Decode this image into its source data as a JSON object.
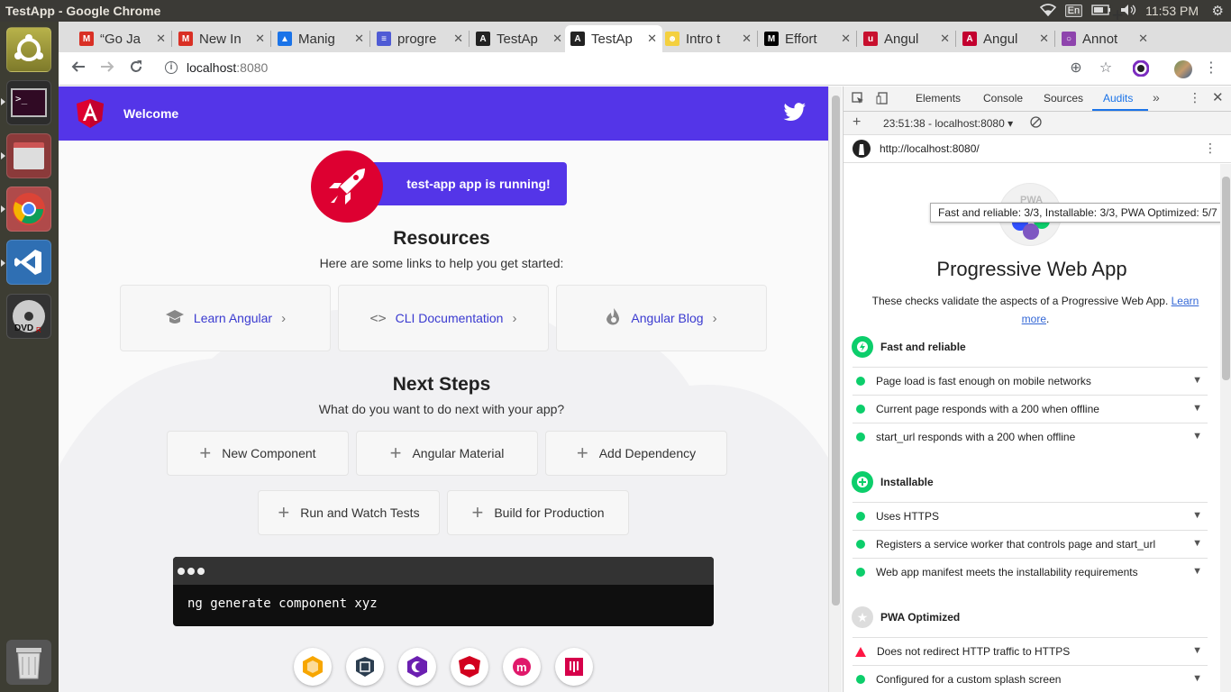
{
  "window": {
    "title": "TestApp - Google Chrome"
  },
  "tray": {
    "keyboard": "En",
    "clock": "11:53 PM"
  },
  "launcher": {
    "items": [
      "ubuntu-home-icon",
      "terminal-icon",
      "files-icon",
      "chrome-icon",
      "vscode-icon",
      "dvd-icon",
      "trash-icon"
    ]
  },
  "tabs": [
    {
      "title": "“Go Ja",
      "favicon": "gmail",
      "color": "#d93025"
    },
    {
      "title": "New In",
      "favicon": "gmail",
      "color": "#d93025"
    },
    {
      "title": "Manig",
      "favicon": "drive",
      "color": "#1a73e8"
    },
    {
      "title": "progre",
      "favicon": "docs",
      "color": "#4f5bd5"
    },
    {
      "title": "TestAp",
      "favicon": "angular",
      "color": "#222"
    },
    {
      "title": "TestAp",
      "favicon": "angular",
      "color": "#222",
      "active": true
    },
    {
      "title": "Intro t",
      "favicon": "intro",
      "color": "#f4d03f"
    },
    {
      "title": "Effort",
      "favicon": "medium",
      "color": "#000"
    },
    {
      "title": "Angul",
      "favicon": "udemy",
      "color": "#c8102e"
    },
    {
      "title": "Angul",
      "favicon": "angular-red",
      "color": "#c3002f"
    },
    {
      "title": "Annot",
      "favicon": "annot",
      "color": "#8e44ad"
    }
  ],
  "address": {
    "host": "localhost",
    "port": ":8080"
  },
  "app": {
    "welcome": "Welcome",
    "running": "test-app app is running!",
    "resources_title": "Resources",
    "resources_sub": "Here are some links to help you get started:",
    "resources": [
      {
        "label": "Learn Angular",
        "icon": "graduation-cap-icon"
      },
      {
        "label": "CLI Documentation",
        "icon": "code-brackets-icon"
      },
      {
        "label": "Angular Blog",
        "icon": "flame-icon"
      }
    ],
    "next_title": "Next Steps",
    "next_sub": "What do you want to do next with your app?",
    "steps": [
      "New Component",
      "Angular Material",
      "Add Dependency",
      "Run and Watch Tests",
      "Build for Production"
    ],
    "terminal_cmd": "ng generate component xyz"
  },
  "devtools": {
    "tabs": [
      "Elements",
      "Console",
      "Sources",
      "Audits"
    ],
    "active_tab": "Audits",
    "session": "23:51:38 - localhost:8080",
    "report_url": "http://localhost:8080/",
    "tooltip": "Fast and reliable: 3/3, Installable: 3/3, PWA Optimized: 5/7",
    "gauge_label": "PWA",
    "pwa_title": "Progressive Web App",
    "pwa_desc": "These checks validate the aspects of a Progressive Web App.",
    "learn": "Learn",
    "more": "more",
    "groups": [
      {
        "name": "Fast and reliable",
        "audits": [
          "Page load is fast enough on mobile networks",
          "Current page responds with a 200 when offline",
          "start_url responds with a 200 when offline"
        ]
      },
      {
        "name": "Installable",
        "audits": [
          "Uses HTTPS",
          "Registers a service worker that controls page and start_url",
          "Web app manifest meets the installability requirements"
        ]
      },
      {
        "name": "PWA Optimized",
        "audits": [
          "Does not redirect HTTP traffic to HTTPS",
          "Configured for a custom splash screen"
        ]
      }
    ]
  }
}
